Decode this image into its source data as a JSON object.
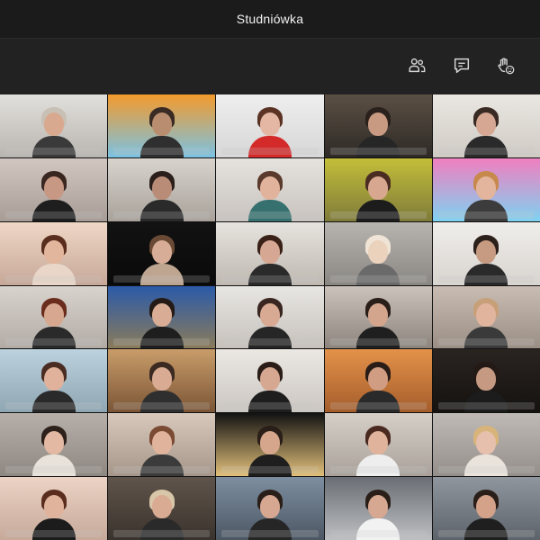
{
  "window": {
    "title": "Studniówka"
  },
  "toolbar": {
    "buttons": [
      {
        "icon": "participants-icon",
        "label": ""
      },
      {
        "icon": "chat-icon",
        "label": ""
      },
      {
        "icon": "raise-hand-icon",
        "label": ""
      }
    ]
  },
  "colors": {
    "titlebar_bg": "#1b1b1b",
    "toolbar_bg": "#222222",
    "icon": "#d6d6d6"
  },
  "video_grid": {
    "rows": 7,
    "columns": 5,
    "tiles": [
      {
        "bg1": "#e2e0dc",
        "bg2": "#b9b5b0",
        "skin": "#d9a98f",
        "hair": "#c8c0b5",
        "shirt": "#3a3a3a"
      },
      {
        "bg1": "#f39a2c",
        "bg2": "#7ac2e4",
        "skin": "#b98d6f",
        "hair": "#3a2b24",
        "shirt": "#2f2f2f"
      },
      {
        "bg1": "#eeeeee",
        "bg2": "#d7d7d7",
        "skin": "#e3b7a3",
        "hair": "#5a3325",
        "shirt": "#d42a2a"
      },
      {
        "bg1": "#5b4f44",
        "bg2": "#2e2a26",
        "skin": "#c99a82",
        "hair": "#2b211c",
        "shirt": "#262626"
      },
      {
        "bg1": "#eae7e2",
        "bg2": "#cfcac4",
        "skin": "#d6a792",
        "hair": "#3a2a24",
        "shirt": "#2a2a2a"
      },
      {
        "bg1": "#d2c7c0",
        "bg2": "#a79c96",
        "skin": "#c79883",
        "hair": "#3a2620",
        "shirt": "#1e1e1e"
      },
      {
        "bg1": "#d8d3cc",
        "bg2": "#a8a29b",
        "skin": "#b98c78",
        "hair": "#2a1f1a",
        "shirt": "#2a2a2a"
      },
      {
        "bg1": "#e5e2de",
        "bg2": "#c8c3be",
        "skin": "#e1b39c",
        "hair": "#5a3a2c",
        "shirt": "#36716f"
      },
      {
        "bg1": "#c3be39",
        "bg2": "#7f7b3a",
        "skin": "#d7a88f",
        "hair": "#4a2c22",
        "shirt": "#1c1c1c"
      },
      {
        "bg1": "#f07fbf",
        "bg2": "#7fd2f1",
        "skin": "#e2b59c",
        "hair": "#c8894d",
        "shirt": "#3c3c3c"
      },
      {
        "bg1": "#efd7c6",
        "bg2": "#c7a898",
        "skin": "#e2b59d",
        "hair": "#5a2e1e",
        "shirt": "#e9d6c9"
      },
      {
        "bg1": "#121212",
        "bg2": "#0a0a0a",
        "skin": "#d8ad97",
        "hair": "#6a4a35",
        "shirt": "#bda590"
      },
      {
        "bg1": "#e6e3de",
        "bg2": "#bfb8b1",
        "skin": "#d6a792",
        "hair": "#3a2118",
        "shirt": "#2a2a2a"
      },
      {
        "bg1": "#b7b4b0",
        "bg2": "#8a8783",
        "skin": "#ead2bd",
        "hair": "#efe4d5",
        "shirt": "#6a6a6a"
      },
      {
        "bg1": "#f0eeeb",
        "bg2": "#d8d4cf",
        "skin": "#c79a82",
        "hair": "#2c201a",
        "shirt": "#2a2a2a"
      },
      {
        "bg1": "#d9d3cd",
        "bg2": "#b3aca6",
        "skin": "#d7a88f",
        "hair": "#6a2c1c",
        "shirt": "#2a2a2a"
      },
      {
        "bg1": "#2b5aa8",
        "bg2": "#8a7b5a",
        "skin": "#d9ad95",
        "hair": "#241b16",
        "shirt": "#1e1e1e"
      },
      {
        "bg1": "#e8e6e3",
        "bg2": "#c6c1bb",
        "skin": "#d8aa93",
        "hair": "#3a2620",
        "shirt": "#262626"
      },
      {
        "bg1": "#cbc3bb",
        "bg2": "#8c847d",
        "skin": "#d4a58d",
        "hair": "#2a1e18",
        "shirt": "#1f1f1f"
      },
      {
        "bg1": "#c9bdb3",
        "bg2": "#9b8e84",
        "skin": "#e0b49d",
        "hair": "#c7a07a",
        "shirt": "#3a3a3a"
      },
      {
        "bg1": "#bcd2de",
        "bg2": "#8fa6b3",
        "skin": "#e0b29b",
        "hair": "#4a2c22",
        "shirt": "#2a2a2a"
      },
      {
        "bg1": "#c99d6a",
        "bg2": "#7b5535",
        "skin": "#d9ab93",
        "hair": "#3b2a22",
        "shirt": "#2f2f2f"
      },
      {
        "bg1": "#ebe8e4",
        "bg2": "#cbc6c1",
        "skin": "#d6a791",
        "hair": "#2a1d17",
        "shirt": "#1e1e1e"
      },
      {
        "bg1": "#e4924a",
        "bg2": "#a55d2b",
        "skin": "#d09d82",
        "hair": "#2a1d17",
        "shirt": "#2a2a2a"
      },
      {
        "bg1": "#2a2421",
        "bg2": "#151210",
        "skin": "#c69a82",
        "hair": "#241a15",
        "shirt": "#1c1c1c"
      },
      {
        "bg1": "#b7b0aa",
        "bg2": "#8f8882",
        "skin": "#e3b9a3",
        "hair": "#2e211b",
        "shirt": "#e8e2da"
      },
      {
        "bg1": "#d8c9bc",
        "bg2": "#a6968a",
        "skin": "#e0b39c",
        "hair": "#7a4a33",
        "shirt": "#3b3b3b"
      },
      {
        "bg1": "#121212",
        "bg2": "#e2c07a",
        "skin": "#d5a68c",
        "hair": "#2a1e18",
        "shirt": "#1e1e1e"
      },
      {
        "bg1": "#d6cfc8",
        "bg2": "#a9a19a",
        "skin": "#e0b39c",
        "hair": "#4a2a20",
        "shirt": "#eeeeee"
      },
      {
        "bg1": "#bfbab5",
        "bg2": "#948f8a",
        "skin": "#e6c0ad",
        "hair": "#d8b47a",
        "shirt": "#e9e3dc"
      },
      {
        "bg1": "#ecd3c5",
        "bg2": "#c6a999",
        "skin": "#e0b39c",
        "hair": "#5a2d1e",
        "shirt": "#1c1c1c"
      },
      {
        "bg1": "#5f544b",
        "bg2": "#3a332d",
        "skin": "#d9ab93",
        "hair": "#d8c6a8",
        "shirt": "#2a2a2a"
      },
      {
        "bg1": "#7d8ea0",
        "bg2": "#4c5764",
        "skin": "#d6a791",
        "hair": "#2a1e18",
        "shirt": "#262626"
      },
      {
        "bg1": "#6a6e74",
        "bg2": "#bdbfc2",
        "skin": "#d6a791",
        "hair": "#2a1e18",
        "shirt": "#f2f2f2"
      },
      {
        "bg1": "#90969d",
        "bg2": "#5d636a",
        "skin": "#d4a189",
        "hair": "#2a1e18",
        "shirt": "#1f1f1f"
      }
    ]
  }
}
